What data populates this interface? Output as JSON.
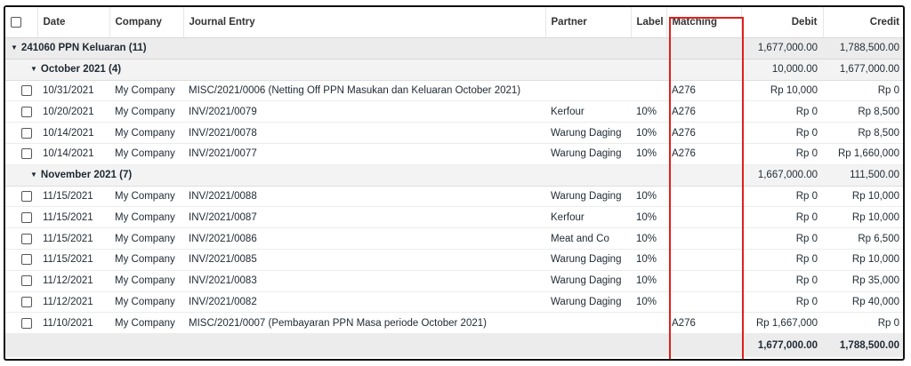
{
  "headers": {
    "date": "Date",
    "company": "Company",
    "journal": "Journal Entry",
    "partner": "Partner",
    "label": "Label",
    "matching": "Matching",
    "debit": "Debit",
    "credit": "Credit"
  },
  "group": {
    "label": "241060 PPN Keluaran (11)",
    "debit": "1,677,000.00",
    "credit": "1,788,500.00"
  },
  "subgroups": [
    {
      "label": "October 2021 (4)",
      "debit": "10,000.00",
      "credit": "1,677,000.00",
      "rows": [
        {
          "date": "10/31/2021",
          "company": "My Company",
          "journal": "MISC/2021/0006 (Netting Off PPN Masukan dan Keluaran October 2021)",
          "partner": "",
          "label": "",
          "matching": "A276",
          "debit": "Rp 10,000",
          "credit": "Rp 0"
        },
        {
          "date": "10/20/2021",
          "company": "My Company",
          "journal": "INV/2021/0079",
          "partner": "Kerfour",
          "label": "10%",
          "matching": "A276",
          "debit": "Rp 0",
          "credit": "Rp 8,500"
        },
        {
          "date": "10/14/2021",
          "company": "My Company",
          "journal": "INV/2021/0078",
          "partner": "Warung Daging",
          "label": "10%",
          "matching": "A276",
          "debit": "Rp 0",
          "credit": "Rp 8,500"
        },
        {
          "date": "10/14/2021",
          "company": "My Company",
          "journal": "INV/2021/0077",
          "partner": "Warung Daging",
          "label": "10%",
          "matching": "A276",
          "debit": "Rp 0",
          "credit": "Rp 1,660,000"
        }
      ]
    },
    {
      "label": "November 2021 (7)",
      "debit": "1,667,000.00",
      "credit": "111,500.00",
      "rows": [
        {
          "date": "11/15/2021",
          "company": "My Company",
          "journal": "INV/2021/0088",
          "partner": "Warung Daging",
          "label": "10%",
          "matching": "",
          "debit": "Rp 0",
          "credit": "Rp 10,000"
        },
        {
          "date": "11/15/2021",
          "company": "My Company",
          "journal": "INV/2021/0087",
          "partner": "Kerfour",
          "label": "10%",
          "matching": "",
          "debit": "Rp 0",
          "credit": "Rp 10,000"
        },
        {
          "date": "11/15/2021",
          "company": "My Company",
          "journal": "INV/2021/0086",
          "partner": "Meat and Co",
          "label": "10%",
          "matching": "",
          "debit": "Rp 0",
          "credit": "Rp 6,500"
        },
        {
          "date": "11/15/2021",
          "company": "My Company",
          "journal": "INV/2021/0085",
          "partner": "Warung Daging",
          "label": "10%",
          "matching": "",
          "debit": "Rp 0",
          "credit": "Rp 10,000"
        },
        {
          "date": "11/12/2021",
          "company": "My Company",
          "journal": "INV/2021/0083",
          "partner": "Warung Daging",
          "label": "10%",
          "matching": "",
          "debit": "Rp 0",
          "credit": "Rp 35,000"
        },
        {
          "date": "11/12/2021",
          "company": "My Company",
          "journal": "INV/2021/0082",
          "partner": "Warung Daging",
          "label": "10%",
          "matching": "",
          "debit": "Rp 0",
          "credit": "Rp 40,000"
        },
        {
          "date": "11/10/2021",
          "company": "My Company",
          "journal": "MISC/2021/0007 (Pembayaran PPN Masa periode October 2021)",
          "partner": "",
          "label": "",
          "matching": "A276",
          "debit": "Rp 1,667,000",
          "credit": "Rp 0"
        }
      ]
    }
  ],
  "footer": {
    "debit": "1,677,000.00",
    "credit": "1,788,500.00"
  },
  "colors": {
    "highlight": "#e0201b",
    "group_bg": "#ececec"
  }
}
